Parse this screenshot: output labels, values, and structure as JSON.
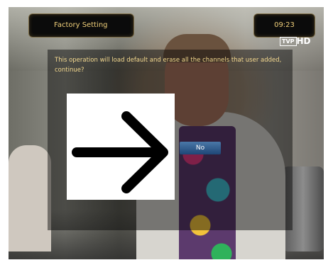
{
  "header": {
    "title": "Factory Setting",
    "time": "09:23"
  },
  "channel_logo": {
    "brand": "TVP",
    "suffix": "HD"
  },
  "dialog": {
    "message": "This operation will load default and erase all the channels that user added, continue?",
    "button_label": "No"
  },
  "overlay": {
    "icon": "arrow-right-icon",
    "color": "#000000"
  },
  "colors": {
    "accent_text": "#f0cf7a",
    "button": "#2f5f95"
  }
}
